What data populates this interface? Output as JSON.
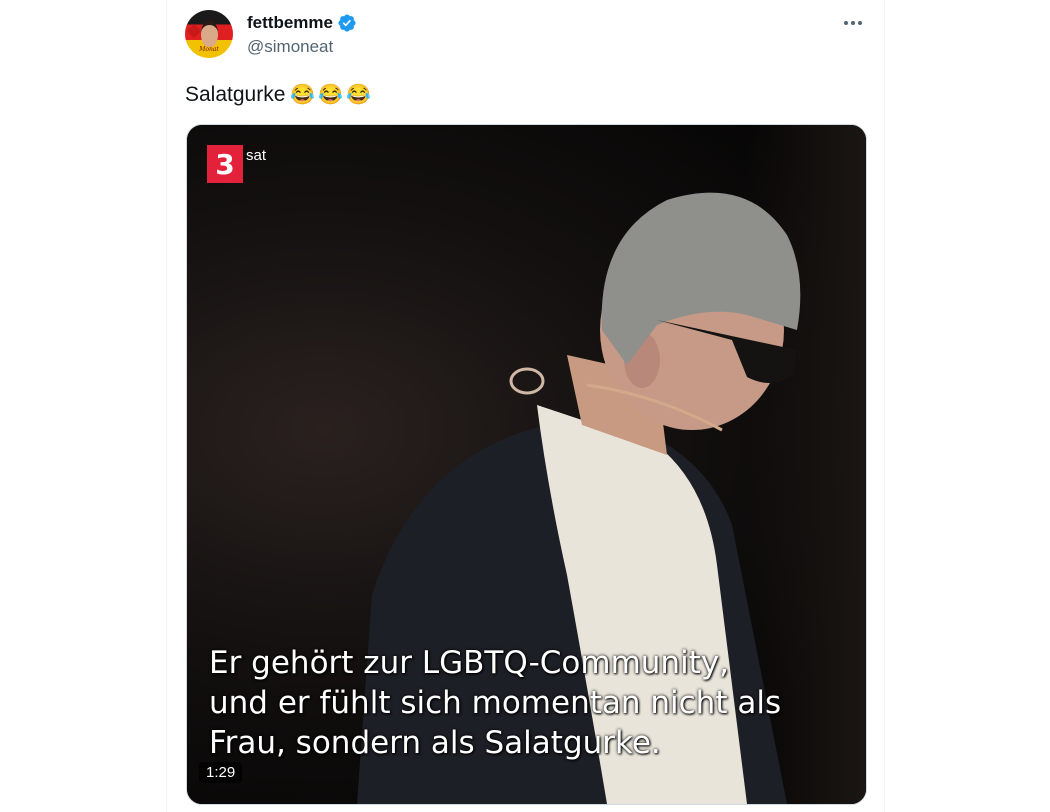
{
  "tweet": {
    "display_name": "fettbemme",
    "handle": "@simoneat",
    "text": "Salatgurke",
    "emojis": [
      "😂",
      "😂",
      "😂"
    ],
    "avatar_text": "Monat"
  },
  "media": {
    "channel_logo_number": "3",
    "channel_logo_text": "sat",
    "subtitle_lines": [
      "Er gehört zur LGBTQ-Community,",
      "und er fühlt sich momentan nicht als",
      "Frau, sondern als Salatgurke."
    ],
    "duration": "1:29"
  },
  "colors": {
    "verified": "#1d9bf0",
    "logo_red": "#e3213a",
    "handle_gray": "#536471"
  }
}
